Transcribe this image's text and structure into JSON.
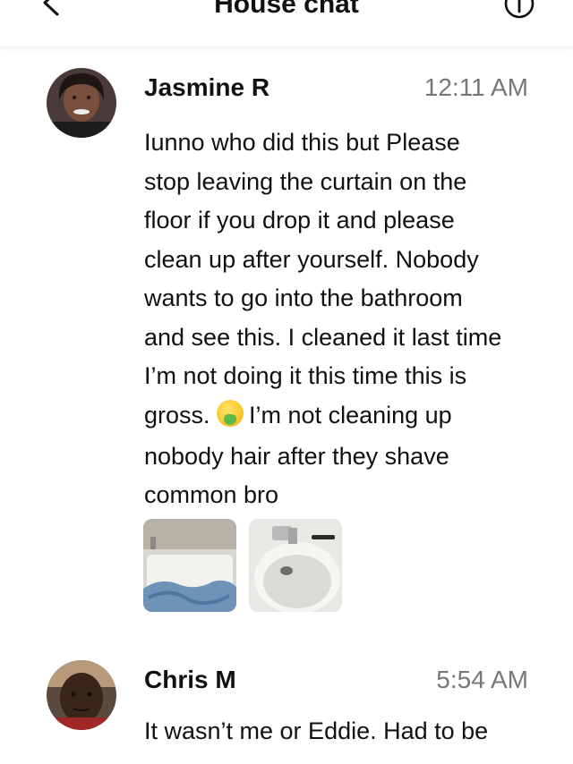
{
  "header": {
    "title": "House chat"
  },
  "messages": [
    {
      "sender": "Jasmine R",
      "time": "12:11 AM",
      "lines": [
        "Iunno who did this but  Please",
        "stop leaving the curtain on the",
        "floor if you drop it and please",
        "clean up after yourself. Nobody",
        "wants to go into the bathroom",
        "and see this. I cleaned it last time",
        "I’m not doing it this time this is",
        "gross.",
        "I’m not cleaning up",
        "nobody hair after they shave",
        "common bro"
      ],
      "emoji": "nauseated-face"
    },
    {
      "sender": "Chris M",
      "time": "5:54 AM",
      "lines": [
        "It wasn’t me or Eddie. Had to be"
      ]
    }
  ]
}
